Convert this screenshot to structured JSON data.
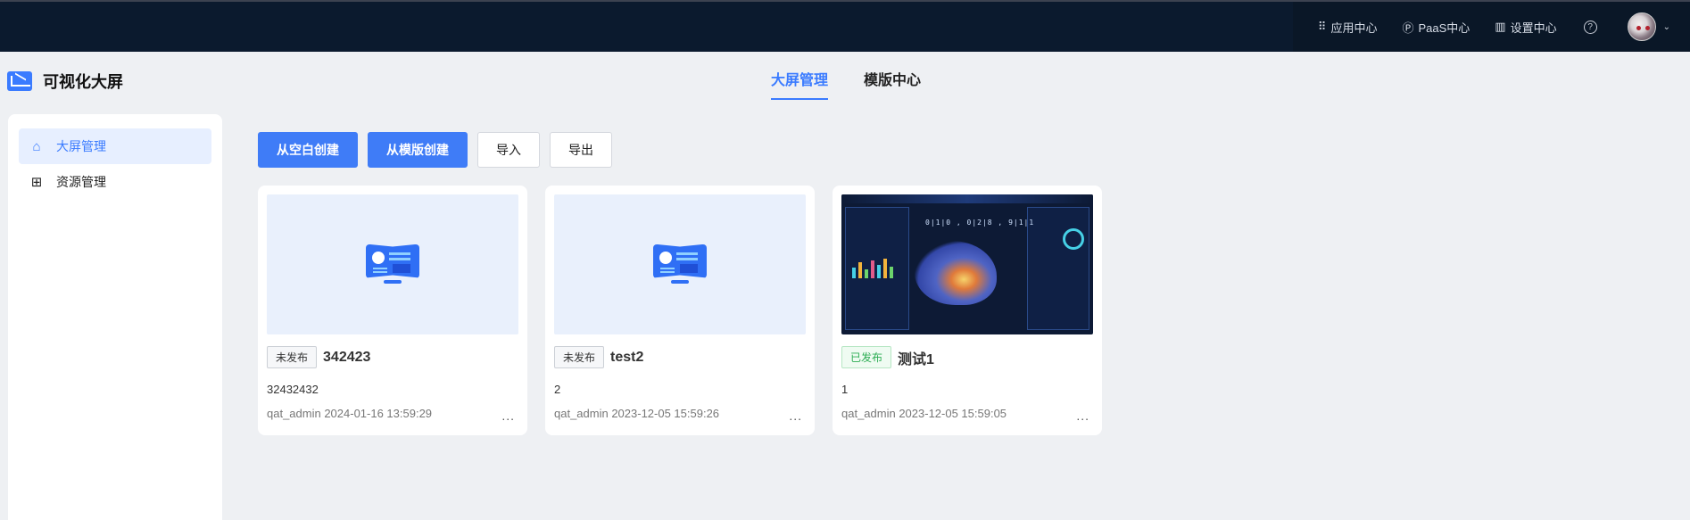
{
  "topnav": {
    "app_center": "应用中心",
    "paas_center": "PaaS中心",
    "settings_center": "设置中心",
    "help": "?"
  },
  "brand": {
    "name": "可视化大屏"
  },
  "tabs": [
    {
      "label": "大屏管理",
      "active": true
    },
    {
      "label": "模版中心",
      "active": false
    }
  ],
  "sidebar": {
    "items": [
      {
        "label": "大屏管理",
        "icon": "home-icon",
        "active": true
      },
      {
        "label": "资源管理",
        "icon": "grid-icon",
        "active": false
      }
    ]
  },
  "toolbar": {
    "create_blank": "从空白创建",
    "create_template": "从模版创建",
    "import": "导入",
    "export": "导出"
  },
  "cards": [
    {
      "status": "未发布",
      "title": "342423",
      "desc": "32432432",
      "meta": "qat_admin 2024-01-16 13:59:29",
      "more": "...",
      "thumb": "placeholder"
    },
    {
      "status": "未发布",
      "title": "test2",
      "desc": "2",
      "meta": "qat_admin 2023-12-05 15:59:26",
      "more": "...",
      "thumb": "placeholder"
    },
    {
      "status": "已发布",
      "title": "测试1",
      "desc": "1",
      "meta": "qat_admin 2023-12-05 15:59:05",
      "more": "...",
      "thumb": "dashboard"
    }
  ],
  "colors": {
    "accent": "#3f7cf7",
    "topbar": "#0b1a2e",
    "published": "#2eae55"
  }
}
